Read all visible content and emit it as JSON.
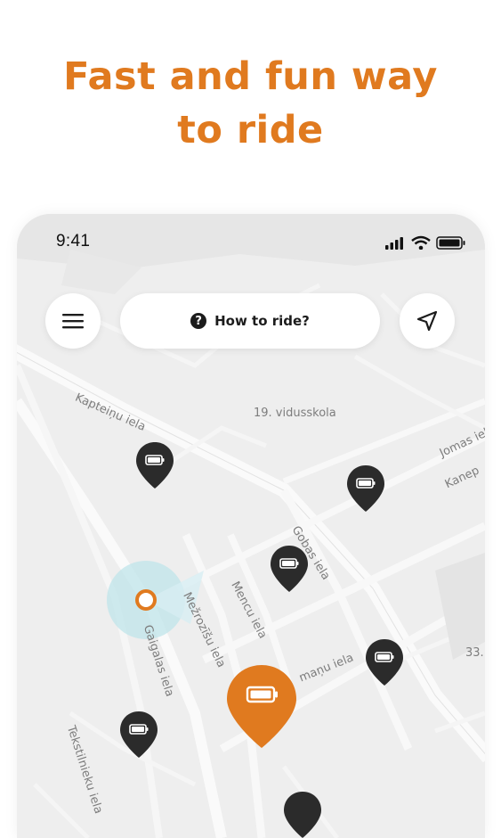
{
  "headline": {
    "line1": "Fast and fun way",
    "line2": "to ride"
  },
  "status_bar": {
    "time": "9:41"
  },
  "top_bar": {
    "how_to_ride": "How to ride?",
    "help_glyph": "?"
  },
  "streets": {
    "kapteinu": "Kapteiņu iela",
    "school": "19. vidusskola",
    "jomas": "Jomas iel",
    "kanepju": "Kanep",
    "gobas": "Gobas iela",
    "mencu": "Mencu iela",
    "mezrozisu": "Mežrozīšu iela",
    "gaigalas": "Gaigalas iela",
    "manu": "maņu iela",
    "tekstilnieku": "Tekstilnieku iela",
    "number33": "33."
  },
  "icons": {
    "menu": "hamburger-menu-icon",
    "locate": "navigation-arrow-icon",
    "help": "question-circle-icon",
    "battery": "battery-icon",
    "signal": "signal-icon",
    "wifi": "wifi-icon"
  },
  "colors": {
    "accent": "#e07a1f",
    "pin_dark": "#2b2b2b",
    "map_bg": "#eeeeee",
    "road": "#fafafa",
    "user_halo": "#bfe4ea"
  }
}
